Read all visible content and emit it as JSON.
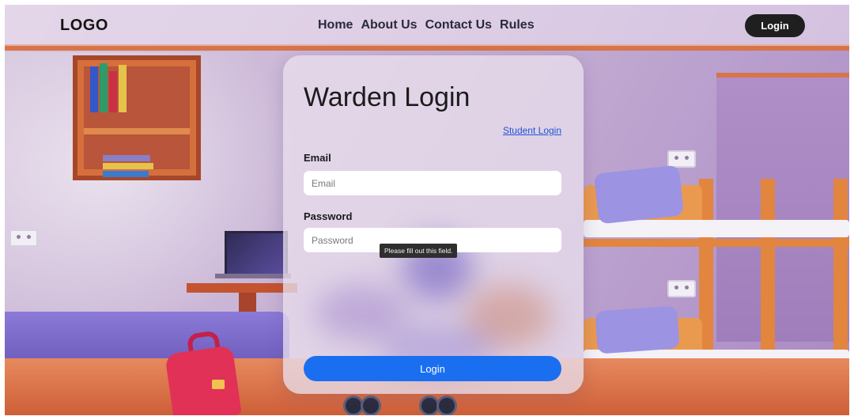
{
  "navbar": {
    "logo": "LOGO",
    "links": [
      "Home",
      "About Us",
      "Contact Us",
      "Rules"
    ],
    "login_button": "Login"
  },
  "login_card": {
    "title": "Warden Login",
    "student_login_link": "Student Login",
    "email": {
      "label": "Email",
      "placeholder": "Email",
      "value": ""
    },
    "password": {
      "label": "Password",
      "placeholder": "Password",
      "value": ""
    },
    "validation_tooltip": "Please fill out this field.",
    "submit_button": "Login"
  },
  "colors": {
    "primary_button": "#1a6ff0",
    "nav_login_button": "#1f1f1f",
    "link": "#1f54d8"
  },
  "background_illustration": "cartoon-hostel-bedroom"
}
